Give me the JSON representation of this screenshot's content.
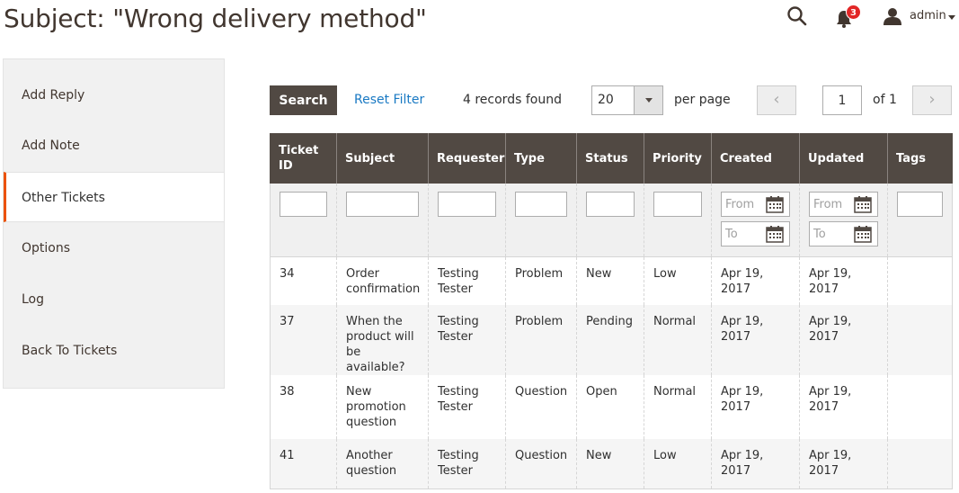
{
  "page": {
    "title": "Subject: \"Wrong delivery method\""
  },
  "header": {
    "notifications_count": "3",
    "user_name": "admin"
  },
  "sidebar": {
    "items": [
      {
        "label": "Add Reply"
      },
      {
        "label": "Add Note"
      },
      {
        "label": "Other Tickets"
      },
      {
        "label": "Options"
      },
      {
        "label": "Log"
      },
      {
        "label": "Back To Tickets"
      }
    ],
    "active_index": 2
  },
  "toolbar": {
    "search_label": "Search",
    "reset_label": "Reset Filter",
    "records_found": "4 records found",
    "per_page_value": "20",
    "per_page_label": "per page",
    "page_current": "1",
    "page_of": "of 1"
  },
  "grid": {
    "columns": [
      "Ticket ID",
      "Subject",
      "Requester",
      "Type",
      "Status",
      "Priority",
      "Created",
      "Updated",
      "Tags"
    ],
    "filter_placeholders": {
      "from": "From",
      "to": "To"
    },
    "rows": [
      {
        "id": "34",
        "subject": "Order confirmation",
        "requester": "Testing Tester",
        "type": "Problem",
        "status": "New",
        "priority": "Low",
        "created": "Apr 19, 2017",
        "updated": "Apr 19, 2017",
        "tags": ""
      },
      {
        "id": "37",
        "subject": "When the product will be available?",
        "requester": "Testing Tester",
        "type": "Problem",
        "status": "Pending",
        "priority": "Normal",
        "created": "Apr 19, 2017",
        "updated": "Apr 19, 2017",
        "tags": ""
      },
      {
        "id": "38",
        "subject": "New promotion question",
        "requester": "Testing Tester",
        "type": "Question",
        "status": "Open",
        "priority": "Normal",
        "created": "Apr 19, 2017",
        "updated": "Apr 19, 2017",
        "tags": ""
      },
      {
        "id": "41",
        "subject": "Another question",
        "requester": "Testing Tester",
        "type": "Question",
        "status": "New",
        "priority": "Low",
        "created": "Apr 19, 2017",
        "updated": "Apr 19, 2017",
        "tags": ""
      }
    ]
  },
  "colors": {
    "accent": "#eb5202",
    "header_bg": "#514943",
    "link": "#1979c3",
    "badge": "#e22626"
  }
}
